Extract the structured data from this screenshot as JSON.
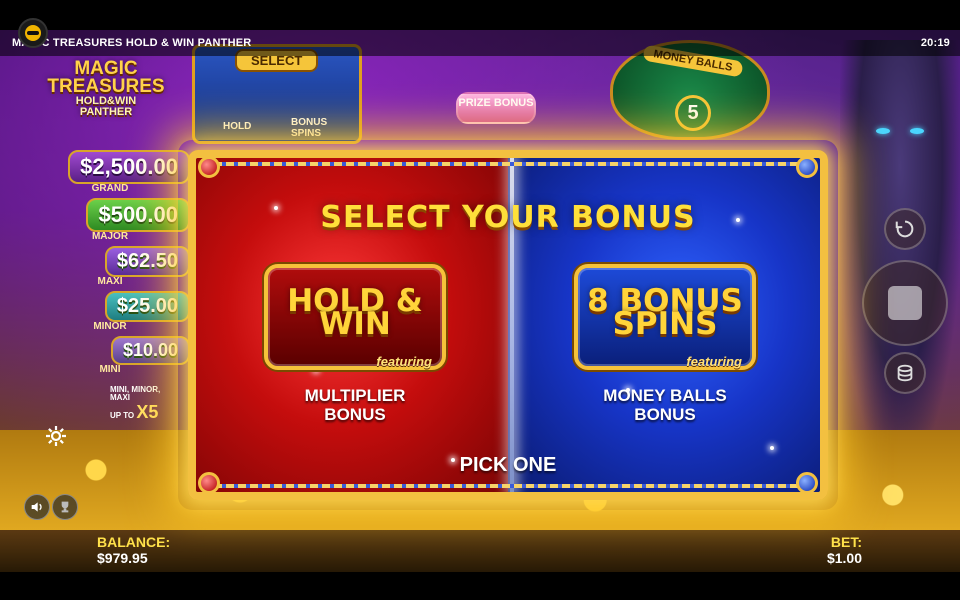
{
  "topbar": {
    "game_title": "MAGIC TREASURES HOLD & WIN PANTHER",
    "clock": "20:19"
  },
  "background": {
    "logo_line1": "MAGIC",
    "logo_line2": "TREASURES",
    "logo_line3": "HOLD&WIN",
    "logo_line4": "PANTHER",
    "chest_select": "SELECT",
    "chest_hold": "HOLD",
    "chest_bonus": "BONUS SPINS",
    "prize_bonus": "PRIZE BONUS",
    "money_balls_tag": "MONEY BALLS",
    "money_balls_count": "5",
    "jackpots": [
      {
        "value": "$2,500.00",
        "label": "GRAND"
      },
      {
        "value": "$500.00",
        "label": "MAJOR"
      },
      {
        "value": "$62.50",
        "label": "MAXI"
      },
      {
        "value": "$25.00",
        "label": "MINOR"
      },
      {
        "value": "$10.00",
        "label": "MINI"
      }
    ],
    "mini_minor_maxi": "MINI, MINOR, MAXI",
    "up_to": "UP TO",
    "multiplier": "X5"
  },
  "modal": {
    "title": "SELECT YOUR BONUS",
    "left_choice": {
      "line1": "HOLD &",
      "line2": "WIN",
      "featuring": "featuring",
      "desc_line1": "MULTIPLIER",
      "desc_line2": "BONUS"
    },
    "right_choice": {
      "line1": "8 BONUS",
      "line2": "SPINS",
      "featuring": "featuring",
      "desc_line1": "MONEY BALLS",
      "desc_line2": "BONUS"
    },
    "pick": "PICK ONE"
  },
  "bottombar": {
    "balance_label": "BALANCE:",
    "balance_value": "$979.95",
    "bet_label": "BET:",
    "bet_value": "$1.00"
  },
  "icons": {
    "settings": "gear-icon",
    "sound": "speaker-icon",
    "trophy": "trophy-icon",
    "autoplay": "autoplay-icon",
    "spin": "spin-stop-icon",
    "bet": "coin-stack-icon"
  },
  "colors": {
    "accent_gold": "#ffe03a",
    "red_side": "#c50d0d",
    "blue_side": "#1735c8",
    "balance_label": "#ffe14a"
  }
}
